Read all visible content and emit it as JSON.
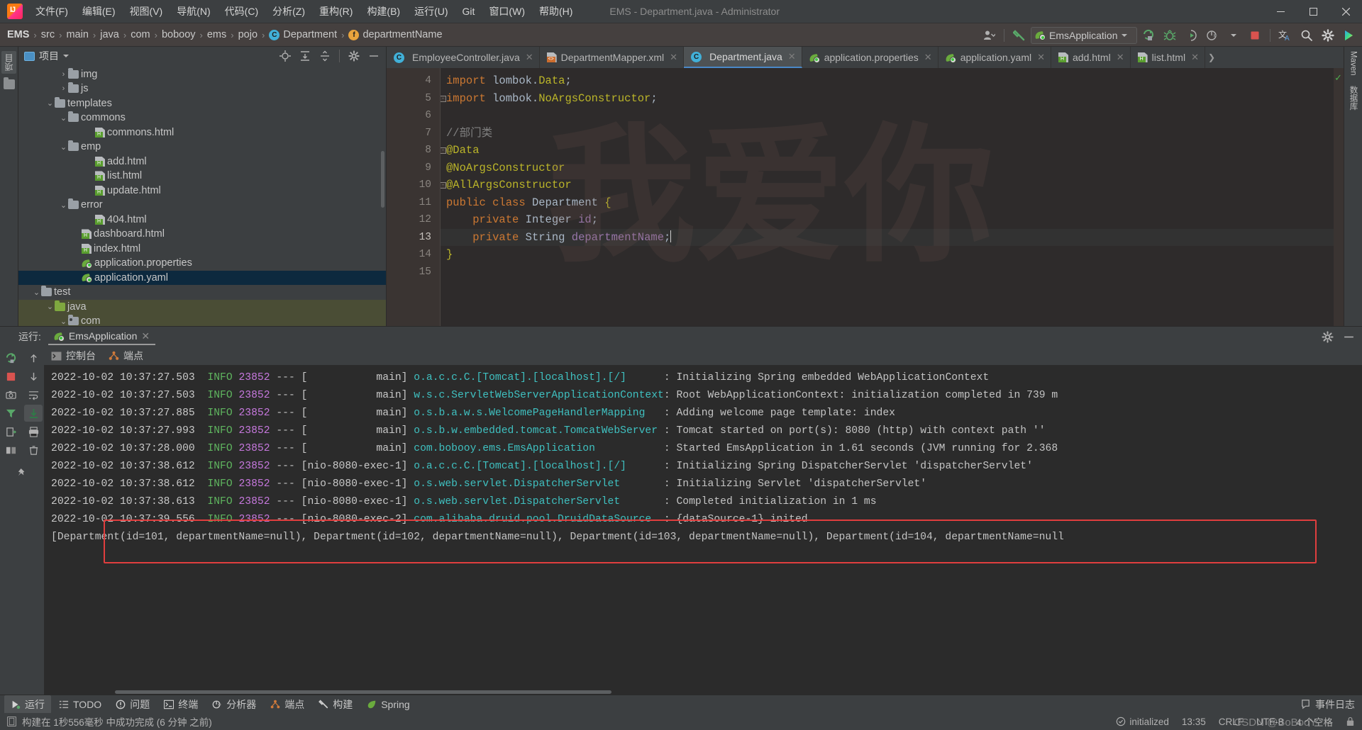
{
  "window": {
    "title": "EMS - Department.java - Administrator",
    "minimize": "—",
    "maximize": "▢",
    "close": "✕"
  },
  "menu": [
    {
      "label": "文件(F)"
    },
    {
      "label": "编辑(E)"
    },
    {
      "label": "视图(V)"
    },
    {
      "label": "导航(N)"
    },
    {
      "label": "代码(C)"
    },
    {
      "label": "分析(Z)"
    },
    {
      "label": "重构(R)"
    },
    {
      "label": "构建(B)"
    },
    {
      "label": "运行(U)"
    },
    {
      "label": "Git"
    },
    {
      "label": "窗口(W)"
    },
    {
      "label": "帮助(H)"
    }
  ],
  "breadcrumb": {
    "items": [
      "EMS",
      "src",
      "main",
      "java",
      "com",
      "bobooy",
      "ems",
      "pojo",
      "Department",
      "departmentName"
    ],
    "separator": "›",
    "class_badge": "C",
    "field_badge": "f"
  },
  "toolbar": {
    "run_config": "EmsApplication",
    "icons": [
      "user-account-icon",
      "build-hammer-icon",
      "run-icon",
      "debug-icon",
      "run-with-coverage-icon",
      "profiler-icon",
      "stop-icon",
      "translate-icon",
      "search-everywhere-icon",
      "settings-icon",
      "plugin-icon"
    ]
  },
  "project_panel": {
    "title": "项目",
    "tools": [
      "locate-icon",
      "expand-all-icon",
      "collapse-all-icon",
      "settings-icon",
      "hide-icon"
    ],
    "tree": [
      {
        "indent": 3,
        "arrow": "›",
        "icon": "folder",
        "label": "img",
        "state": "normal"
      },
      {
        "indent": 3,
        "arrow": "›",
        "icon": "folder",
        "label": "js",
        "state": "normal"
      },
      {
        "indent": 2,
        "arrow": "⌄",
        "icon": "folder",
        "label": "templates",
        "state": "normal"
      },
      {
        "indent": 3,
        "arrow": "⌄",
        "icon": "folder",
        "label": "commons",
        "state": "normal"
      },
      {
        "indent": 5,
        "arrow": "",
        "icon": "html",
        "label": "commons.html",
        "state": "normal"
      },
      {
        "indent": 3,
        "arrow": "⌄",
        "icon": "folder",
        "label": "emp",
        "state": "normal"
      },
      {
        "indent": 5,
        "arrow": "",
        "icon": "html",
        "label": "add.html",
        "state": "normal"
      },
      {
        "indent": 5,
        "arrow": "",
        "icon": "html",
        "label": "list.html",
        "state": "normal"
      },
      {
        "indent": 5,
        "arrow": "",
        "icon": "html",
        "label": "update.html",
        "state": "normal"
      },
      {
        "indent": 3,
        "arrow": "⌄",
        "icon": "folder",
        "label": "error",
        "state": "normal"
      },
      {
        "indent": 5,
        "arrow": "",
        "icon": "html",
        "label": "404.html",
        "state": "normal"
      },
      {
        "indent": 4,
        "arrow": "",
        "icon": "html",
        "label": "dashboard.html",
        "state": "normal"
      },
      {
        "indent": 4,
        "arrow": "",
        "icon": "html",
        "label": "index.html",
        "state": "normal"
      },
      {
        "indent": 4,
        "arrow": "",
        "icon": "spring",
        "label": "application.properties",
        "state": "normal"
      },
      {
        "indent": 4,
        "arrow": "",
        "icon": "spring",
        "label": "application.yaml",
        "state": "selected"
      },
      {
        "indent": 1,
        "arrow": "⌄",
        "icon": "folder",
        "label": "test",
        "state": "normal"
      },
      {
        "indent": 2,
        "arrow": "⌄",
        "icon": "folder-green",
        "label": "java",
        "state": "green"
      },
      {
        "indent": 3,
        "arrow": "⌄",
        "icon": "folder-pkg",
        "label": "com",
        "state": "green"
      }
    ]
  },
  "editor_tabs": [
    {
      "label": "EmployeeController.java",
      "icon": "java-class-icon",
      "active": false,
      "close": "✕"
    },
    {
      "label": "DepartmentMapper.xml",
      "icon": "xml-file-icon",
      "active": false,
      "close": "✕"
    },
    {
      "label": "Department.java",
      "icon": "java-class-icon",
      "active": true,
      "close": "✕"
    },
    {
      "label": "application.properties",
      "icon": "spring-icon",
      "active": false,
      "close": "✕"
    },
    {
      "label": "application.yaml",
      "icon": "spring-icon",
      "active": false,
      "close": "✕"
    },
    {
      "label": "add.html",
      "icon": "html-file-icon",
      "active": false,
      "close": "✕"
    },
    {
      "label": "list.html",
      "icon": "html-file-icon",
      "active": false,
      "close": "✕"
    }
  ],
  "editor": {
    "watermark": "我爱你",
    "lines": [
      {
        "no": "4",
        "fold": "",
        "html": "<span class='kw'>import</span> lombok.<span class='ann'>Data</span>;",
        "current": false
      },
      {
        "no": "5",
        "fold": "-",
        "html": "<span class='kw'>import</span> lombok.<span class='ann'>NoArgsConstructor</span>;",
        "current": false
      },
      {
        "no": "6",
        "fold": "",
        "html": "",
        "current": false
      },
      {
        "no": "7",
        "fold": "",
        "html": "<span class='cmt'>//部门类</span>",
        "current": false
      },
      {
        "no": "8",
        "fold": "-",
        "html": "<span class='ann'>@Data</span>",
        "current": false
      },
      {
        "no": "9",
        "fold": "",
        "html": "<span class='ann'>@NoArgsConstructor</span>",
        "current": false
      },
      {
        "no": "10",
        "fold": "-",
        "html": "<span class='ann'>@AllArgsConstructor</span>",
        "current": false
      },
      {
        "no": "11",
        "fold": "",
        "html": "<span class='kw'>public</span> <span class='kw'>class</span> <span class='cls'>Department</span> <span class='ann'>{</span>",
        "current": false
      },
      {
        "no": "12",
        "fold": "",
        "html": "    <span class='kw'>private</span> <span class='typ'>Integer</span> <span class='fld'>id</span>;",
        "current": false
      },
      {
        "no": "13",
        "fold": "",
        "html": "    <span class='kw'>private</span> <span class='typ'>String</span> <span class='fld'>departmentName</span>;<span class='caret'></span>",
        "current": true
      },
      {
        "no": "14",
        "fold": "",
        "html": "<span class='ann'>}</span>",
        "current": false
      },
      {
        "no": "15",
        "fold": "",
        "html": "",
        "current": false
      }
    ],
    "inspection_ok": "✓"
  },
  "run_panel": {
    "label": "运行:",
    "tab": "EmsApplication",
    "tab_close": "✕",
    "console_tabs": [
      {
        "label": "控制台",
        "icon": "console-icon"
      },
      {
        "label": "端点",
        "icon": "endpoints-icon"
      }
    ],
    "header_tools": [
      "settings-icon",
      "hide-icon"
    ],
    "side_tools": [
      "rerun-icon",
      "scroll-up-icon",
      "stop-icon",
      "scroll-down-icon",
      "camera-icon",
      "wrap-icon",
      "filter-icon",
      "scroll-end-icon",
      "export-icon",
      "print-icon",
      "layout-icon",
      "trash-icon"
    ],
    "log": [
      {
        "ts": "2022-10-02 10:37:27.503",
        "level": "INFO",
        "pid": "23852",
        "thread": "main",
        "logger": "o.a.c.c.C.[Tomcat].[localhost].[/]",
        "msg": "Initializing Spring embedded WebApplicationContext"
      },
      {
        "ts": "2022-10-02 10:37:27.503",
        "level": "INFO",
        "pid": "23852",
        "thread": "main",
        "logger": "w.s.c.ServletWebServerApplicationContext",
        "msg": "Root WebApplicationContext: initialization completed in 739 m"
      },
      {
        "ts": "2022-10-02 10:37:27.885",
        "level": "INFO",
        "pid": "23852",
        "thread": "main",
        "logger": "o.s.b.a.w.s.WelcomePageHandlerMapping",
        "msg": "Adding welcome page template: index"
      },
      {
        "ts": "2022-10-02 10:37:27.993",
        "level": "INFO",
        "pid": "23852",
        "thread": "main",
        "logger": "o.s.b.w.embedded.tomcat.TomcatWebServer",
        "msg": "Tomcat started on port(s): 8080 (http) with context path ''"
      },
      {
        "ts": "2022-10-02 10:37:28.000",
        "level": "INFO",
        "pid": "23852",
        "thread": "main",
        "logger": "com.bobooy.ems.EmsApplication",
        "msg": "Started EmsApplication in 1.61 seconds (JVM running for 2.368"
      },
      {
        "ts": "2022-10-02 10:37:38.612",
        "level": "INFO",
        "pid": "23852",
        "thread": "nio-8080-exec-1",
        "logger": "o.a.c.c.C.[Tomcat].[localhost].[/]",
        "msg": "Initializing Spring DispatcherServlet 'dispatcherServlet'"
      },
      {
        "ts": "2022-10-02 10:37:38.612",
        "level": "INFO",
        "pid": "23852",
        "thread": "nio-8080-exec-1",
        "logger": "o.s.web.servlet.DispatcherServlet",
        "msg": "Initializing Servlet 'dispatcherServlet'"
      },
      {
        "ts": "2022-10-02 10:37:38.613",
        "level": "INFO",
        "pid": "23852",
        "thread": "nio-8080-exec-1",
        "logger": "o.s.web.servlet.DispatcherServlet",
        "msg": "Completed initialization in 1 ms"
      },
      {
        "ts": "2022-10-02 10:37:39.556",
        "level": "INFO",
        "pid": "23852",
        "thread": "nio-8080-exec-2",
        "logger": "com.alibaba.druid.pool.DruidDataSource",
        "msg": "{dataSource-1} inited"
      }
    ],
    "highlighted_output": "[Department(id=101, departmentName=null), Department(id=102, departmentName=null), Department(id=103, departmentName=null), Department(id=104, departmentName=null",
    "highlight_color": "#e03e3e"
  },
  "tool_window_bar": {
    "items": [
      {
        "label": "运行",
        "icon": "run-icon",
        "active": true
      },
      {
        "label": "TODO",
        "icon": "todo-icon",
        "active": false
      },
      {
        "label": "问题",
        "icon": "problems-icon",
        "active": false
      },
      {
        "label": "终端",
        "icon": "terminal-icon",
        "active": false
      },
      {
        "label": "分析器",
        "icon": "profiler-icon",
        "active": false
      },
      {
        "label": "端点",
        "icon": "endpoints-icon",
        "active": false
      },
      {
        "label": "构建",
        "icon": "build-icon",
        "active": false
      },
      {
        "label": "Spring",
        "icon": "spring-icon",
        "active": false
      }
    ],
    "event_log": "事件日志"
  },
  "status_bar": {
    "build_message": "构建在 1秒556毫秒 中成功完成 (6 分钟 之前)",
    "items": [
      "initialized",
      "13:35",
      "CRLF",
      "UTF-8",
      "4 个空格"
    ],
    "watermark": "CSDN @BoBooY-"
  },
  "left_strip": {
    "tabs": [
      "项目"
    ],
    "icons": [
      "structure-icon"
    ]
  },
  "right_strip": {
    "tabs": [
      "Maven",
      "数据库"
    ]
  }
}
